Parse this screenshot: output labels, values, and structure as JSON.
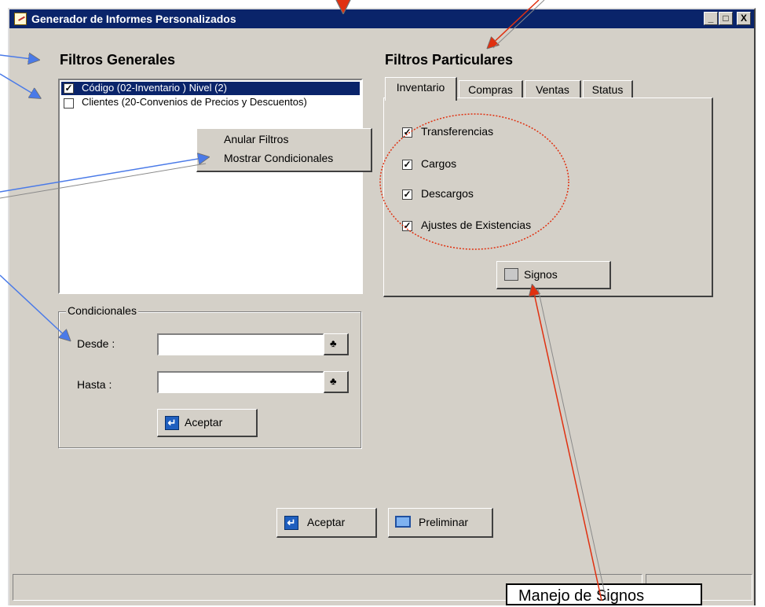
{
  "window": {
    "title": "Generador de Informes Personalizados",
    "controls": [
      "_",
      "□",
      "X"
    ]
  },
  "filtros_generales": {
    "heading": "Filtros Generales",
    "items": [
      {
        "label": "Código  (02-Inventario ) Nivel (2)",
        "checked": true,
        "selected": true
      },
      {
        "label": "Clientes  (20-Convenios de Precios y Descuentos)",
        "checked": false,
        "selected": false
      }
    ]
  },
  "context_menu": {
    "items": [
      "Anular Filtros",
      "Mostrar Condicionales"
    ]
  },
  "condicionales": {
    "legend": "Condicionales",
    "desde_label": "Desde :",
    "hasta_label": "Hasta :",
    "desde_value": "",
    "hasta_value": "",
    "accept_label": "Aceptar"
  },
  "filtros_particulares": {
    "heading": "Filtros Particulares",
    "tabs": [
      "Inventario",
      "Compras",
      "Ventas",
      "Status"
    ],
    "active_tab": "Inventario",
    "options": [
      {
        "label": "Transferencias",
        "checked": true
      },
      {
        "label": "Cargos",
        "checked": true
      },
      {
        "label": "Descargos",
        "checked": true
      },
      {
        "label": "Ajustes de Existencias",
        "checked": true
      }
    ],
    "signos_label": "Signos"
  },
  "footer": {
    "accept_label": "Aceptar",
    "preview_label": "Preliminar"
  },
  "tooltip": {
    "text": "Manejo de Signos"
  },
  "colors": {
    "title_bar": "#0a246a",
    "face": "#d4d0c8",
    "arrow_blue": "#4a7ae8",
    "arrow_red": "#e03010",
    "selection": "#0a246a"
  }
}
